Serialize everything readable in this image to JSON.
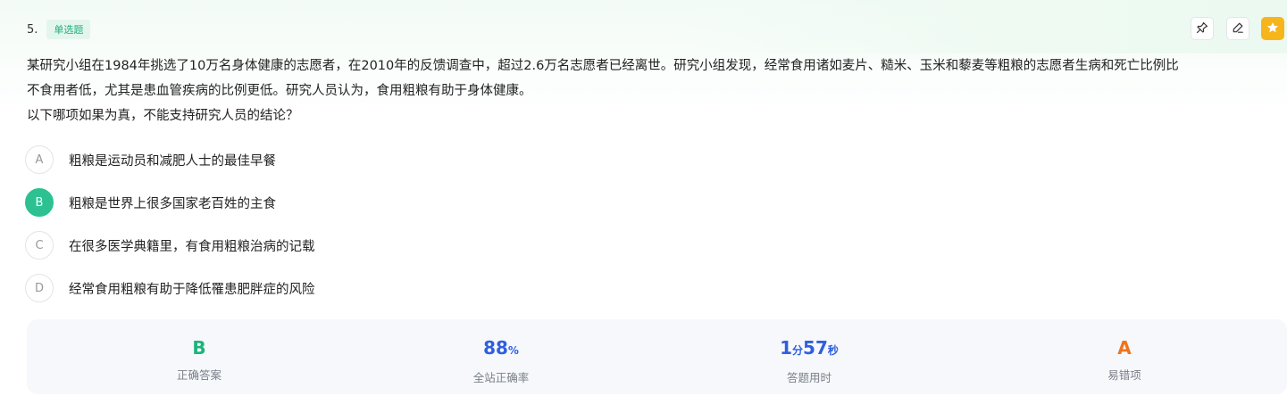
{
  "question": {
    "number": "5.",
    "type_tag": "单选题",
    "stem_lines": [
      "某研究小组在1984年挑选了10万名身体健康的志愿者，在2010年的反馈调查中，超过2.6万名志愿者已经离世。研究小组发现，经常食用诸如麦片、糙米、玉米和藜麦等粗粮的志愿者生病和死亡比例比",
      "不食用者低，尤其是患血管疾病的比例更低。研究人员认为，食用粗粮有助于身体健康。",
      "以下哪项如果为真，不能支持研究人员的结论？"
    ]
  },
  "tools": {
    "pin": "pin-icon",
    "edit": "edit-icon",
    "favorite": "star-icon"
  },
  "options": [
    {
      "letter": "A",
      "text": "粗粮是运动员和减肥人士的最佳早餐",
      "selected": false
    },
    {
      "letter": "B",
      "text": "粗粮是世界上很多国家老百姓的主食",
      "selected": true
    },
    {
      "letter": "C",
      "text": "在很多医学典籍里，有食用粗粮治病的记载",
      "selected": false
    },
    {
      "letter": "D",
      "text": "经常食用粗粮有助于降低罹患肥胖症的风险",
      "selected": false
    }
  ],
  "stats": {
    "correct_answer": {
      "value": "B",
      "label": "正确答案",
      "color": "#1cb57c"
    },
    "accuracy": {
      "value": "88",
      "unit": "%",
      "label": "全站正确率",
      "color": "#2f5fe0"
    },
    "time": {
      "minutes": "1",
      "minutes_unit": "分",
      "seconds": "57",
      "seconds_unit": "秒",
      "label": "答题用时",
      "color": "#2f5fe0"
    },
    "common_wrong": {
      "value": "A",
      "label": "易错项",
      "color": "#f0731c"
    }
  },
  "colors": {
    "accent_green": "#2dc191",
    "tag_green": "#21b07a",
    "star_yellow": "#f7b51c"
  }
}
